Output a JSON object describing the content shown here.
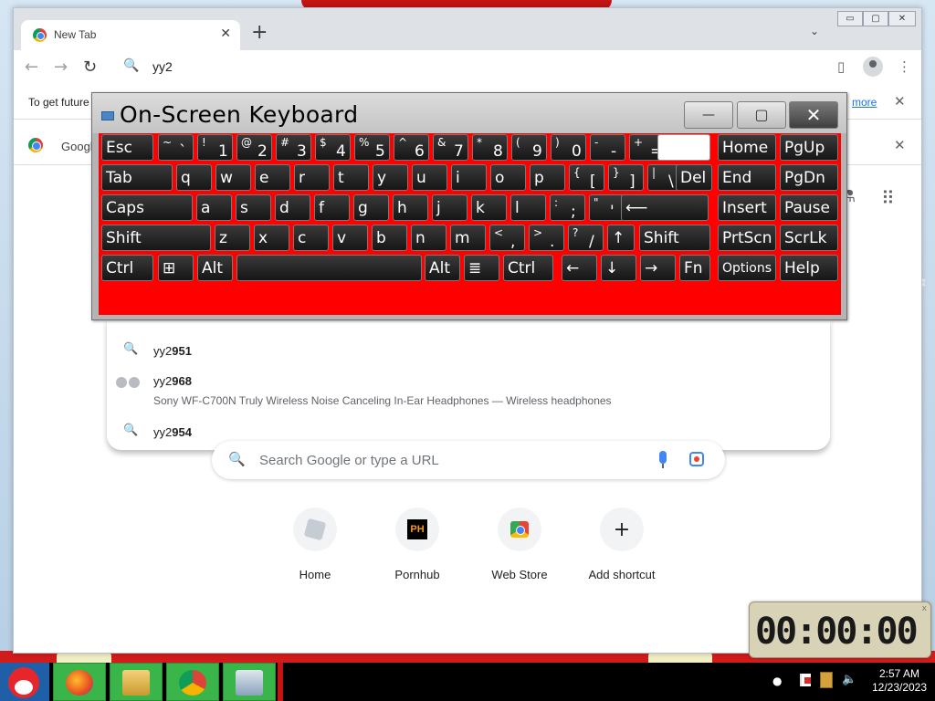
{
  "browser": {
    "tab_title": "New Tab",
    "tab_close": "✕",
    "new_tab": "+",
    "tab_search": "⌄",
    "window_controls": [
      "▭",
      "▢",
      "✕"
    ],
    "back": "←",
    "forward": "→",
    "reload": "↻",
    "address_value": "yy2",
    "search_icon": "🔍",
    "side_panel": "▯",
    "menu": "⋮"
  },
  "infobar": {
    "text": "To get future",
    "link": "more",
    "close": "✕"
  },
  "bar2": {
    "text": "Googl",
    "close": "✕"
  },
  "suggestions": [
    {
      "prefix": "yy2",
      "bold": "951"
    },
    {
      "prefix": "yy2",
      "bold": "968",
      "sub": "Sony WF-C700N Truly Wireless Noise Canceling In-Ear Headphones — Wireless headphones"
    },
    {
      "prefix": "yy2",
      "bold": "954"
    }
  ],
  "search": {
    "placeholder": "Search Google or type a URL"
  },
  "shortcuts": [
    {
      "label": "Home"
    },
    {
      "label": "Pornhub",
      "logo_text": "PH"
    },
    {
      "label": "Web Store"
    },
    {
      "label": "Add shortcut",
      "glyph": "+"
    }
  ],
  "osk": {
    "title": "On-Screen Keyboard",
    "minimize": "—",
    "restore": "▢",
    "close": "✕",
    "rows": [
      [
        {
          "label": "Esc"
        },
        {
          "shift": "~",
          "main": "`"
        },
        {
          "shift": "!",
          "main": "1"
        },
        {
          "shift": "@",
          "main": "2"
        },
        {
          "shift": "#",
          "main": "3"
        },
        {
          "shift": "$",
          "main": "4"
        },
        {
          "shift": "%",
          "main": "5"
        },
        {
          "shift": "^",
          "main": "6"
        },
        {
          "shift": "&",
          "main": "7"
        },
        {
          "shift": "*",
          "main": "8"
        },
        {
          "shift": "(",
          "main": "9"
        },
        {
          "shift": ")",
          "main": "0"
        },
        {
          "shift": "-",
          "main": "-"
        },
        {
          "shift": "+",
          "main": "="
        },
        {
          "label": ""
        },
        {
          "label": "Home"
        },
        {
          "label": "PgUp"
        }
      ],
      [
        {
          "label": "Tab"
        },
        {
          "label": "q"
        },
        {
          "label": "w"
        },
        {
          "label": "e"
        },
        {
          "label": "r"
        },
        {
          "label": "t"
        },
        {
          "label": "y"
        },
        {
          "label": "u"
        },
        {
          "label": "i"
        },
        {
          "label": "o"
        },
        {
          "label": "p"
        },
        {
          "shift": "{",
          "main": "["
        },
        {
          "shift": "}",
          "main": "]"
        },
        {
          "shift": "|",
          "main": "\\"
        },
        {
          "label": "Del"
        },
        {
          "label": "End"
        },
        {
          "label": "PgDn"
        }
      ],
      [
        {
          "label": "Caps"
        },
        {
          "label": "a"
        },
        {
          "label": "s"
        },
        {
          "label": "d"
        },
        {
          "label": "f"
        },
        {
          "label": "g"
        },
        {
          "label": "h"
        },
        {
          "label": "j"
        },
        {
          "label": "k"
        },
        {
          "label": "l"
        },
        {
          "shift": ":",
          "main": ";"
        },
        {
          "shift": "\"",
          "main": "'"
        },
        {
          "label": "⟵"
        },
        {
          "label": "Insert"
        },
        {
          "label": "Pause"
        }
      ],
      [
        {
          "label": "Shift"
        },
        {
          "label": "z"
        },
        {
          "label": "x"
        },
        {
          "label": "c"
        },
        {
          "label": "v"
        },
        {
          "label": "b"
        },
        {
          "label": "n"
        },
        {
          "label": "m"
        },
        {
          "shift": "<",
          "main": ","
        },
        {
          "shift": ">",
          "main": "."
        },
        {
          "shift": "?",
          "main": "/"
        },
        {
          "label": "↑"
        },
        {
          "label": "Shift"
        },
        {
          "label": "PrtScn"
        },
        {
          "label": "ScrLk"
        }
      ],
      [
        {
          "label": "Ctrl"
        },
        {
          "label": "⊞"
        },
        {
          "label": "Alt"
        },
        {
          "label": ""
        },
        {
          "label": "Alt"
        },
        {
          "label": "≣"
        },
        {
          "label": "Ctrl"
        },
        {
          "label": "←"
        },
        {
          "label": "↓"
        },
        {
          "label": "→"
        },
        {
          "label": "Fn"
        },
        {
          "label": "Options"
        },
        {
          "label": "Help"
        }
      ]
    ]
  },
  "clock": {
    "digits": "00:00:00",
    "close": "x"
  },
  "taskbar": {
    "time": "2:57 AM",
    "date": "12/23/2023",
    "tray_dot": "●",
    "volume": "🔈"
  },
  "colors": {
    "osk_body": "#ff0000",
    "taskbar_app": "#39b54a",
    "chrome_tabstrip": "#dee1e6"
  }
}
